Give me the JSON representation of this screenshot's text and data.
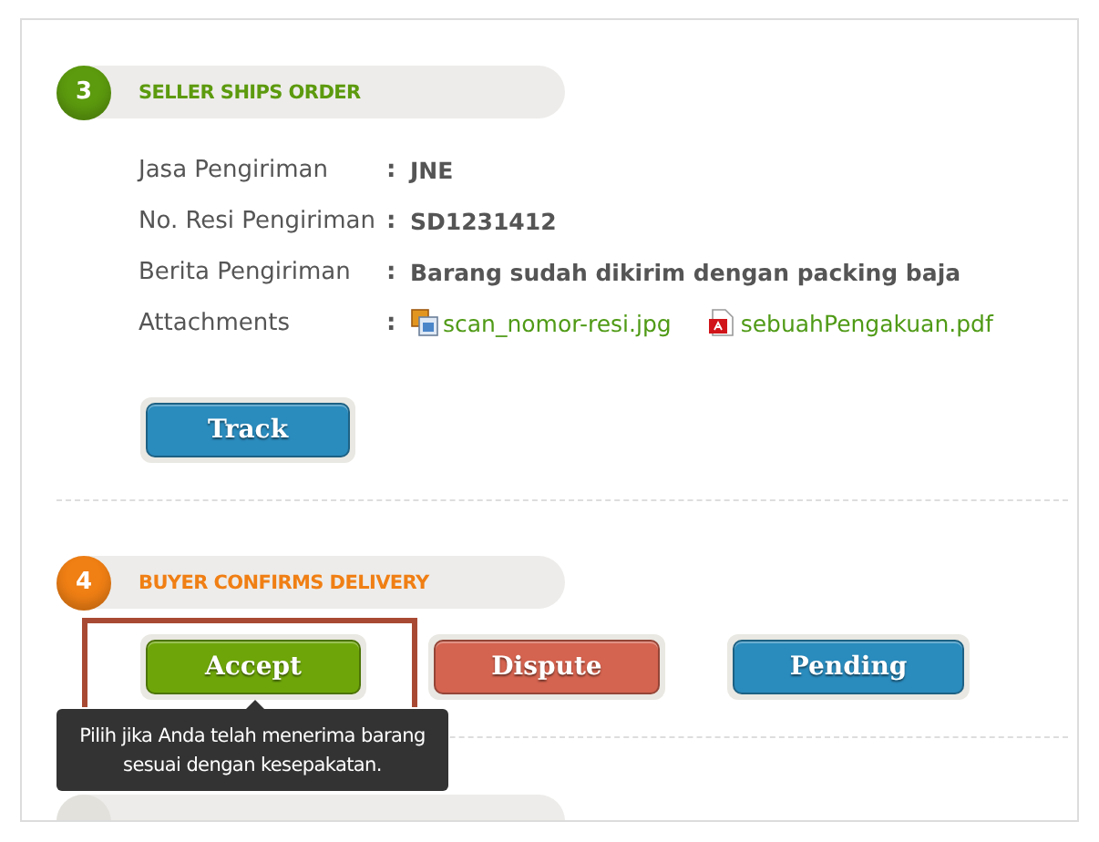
{
  "sections": [
    {
      "number": "3",
      "title": "SELLER SHIPS ORDER",
      "color": "#5c9a0e",
      "details": [
        {
          "label": "Jasa Pengiriman",
          "separator": ":",
          "value": "JNE"
        },
        {
          "label": "No. Resi Pengiriman",
          "separator": ":",
          "value": "SD1231412"
        },
        {
          "label": "Berita Pengiriman",
          "separator": ":",
          "value": "Barang sudah dikirim dengan packing baja"
        }
      ],
      "attachments": {
        "label": "Attachments",
        "separator": ":",
        "files": [
          {
            "kind": "image",
            "name": "scan_nomor-resi.jpg"
          },
          {
            "kind": "pdf",
            "name": "sebuahPengakuan.pdf"
          }
        ]
      },
      "track_button": {
        "label": "Track",
        "color": "#2a8bbd"
      }
    },
    {
      "number": "4",
      "title": "BUYER CONFIRMS DELIVERY",
      "color": "#f07f14",
      "actions": [
        {
          "label": "Accept",
          "color": "#6ea60a",
          "highlighted": true
        },
        {
          "label": "Dispute",
          "color": "#d4634f",
          "highlighted": false
        },
        {
          "label": "Pending",
          "color": "#2a8bbd",
          "highlighted": false
        }
      ],
      "tooltip": "Pilih jika Anda telah menerima barang sesuai dengan kesepakatan."
    }
  ]
}
